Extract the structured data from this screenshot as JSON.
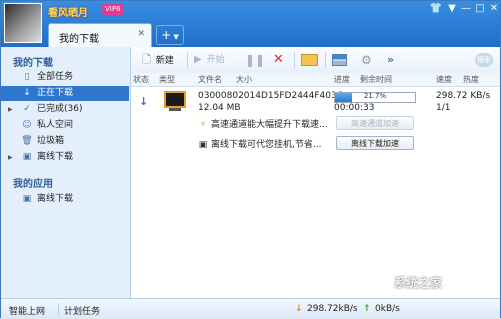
{
  "header": {
    "username": "看风晒月",
    "vip_badge": "VIP6",
    "controls": [
      "▼",
      "—",
      "□",
      "✕"
    ],
    "active_tab": "我的下载",
    "tab_close": "✕",
    "add_tab": "+"
  },
  "sidebar": {
    "downloads_heading": "我的下载",
    "items": [
      {
        "label": "全部任务",
        "icon": "page-icon"
      },
      {
        "label": "正在下载",
        "icon": "arrow-down-icon"
      },
      {
        "label": "已完成(36)",
        "icon": "check-icon"
      },
      {
        "label": "私人空间",
        "icon": "person-icon"
      },
      {
        "label": "垃圾箱",
        "icon": "trash-icon"
      },
      {
        "label": "离线下载",
        "icon": "offline-icon"
      }
    ],
    "apps_heading": "我的应用",
    "apps": [
      {
        "label": "离线下载",
        "icon": "offline-icon"
      }
    ]
  },
  "toolbar": {
    "new_label": "新建",
    "start_label": "开始",
    "more": "»",
    "search": "搜索"
  },
  "columns": [
    "状态",
    "类型",
    "文件名",
    "大小",
    "进度",
    "剩余时间",
    "速度",
    "热度"
  ],
  "task": {
    "name": "03000802014D15FD2444F403C...",
    "size": "12.04 MB",
    "progress_text": "21.7%",
    "progress_value": 21.7,
    "remaining": "00:00:33",
    "speed": "298.72 KB/s",
    "ratio": "1/1",
    "hint1": "高速通道能大幅提升下载速...",
    "hint1_button": "高速通道加速",
    "hint2": "离线下载可代您挂机,节省...",
    "hint2_button": "离线下载加速"
  },
  "statusbar": {
    "smart": "智能上网",
    "schedule": "计划任务",
    "down_speed": "298.72kB/s",
    "up_speed": "0kB/s"
  },
  "watermark": "系统之家"
}
